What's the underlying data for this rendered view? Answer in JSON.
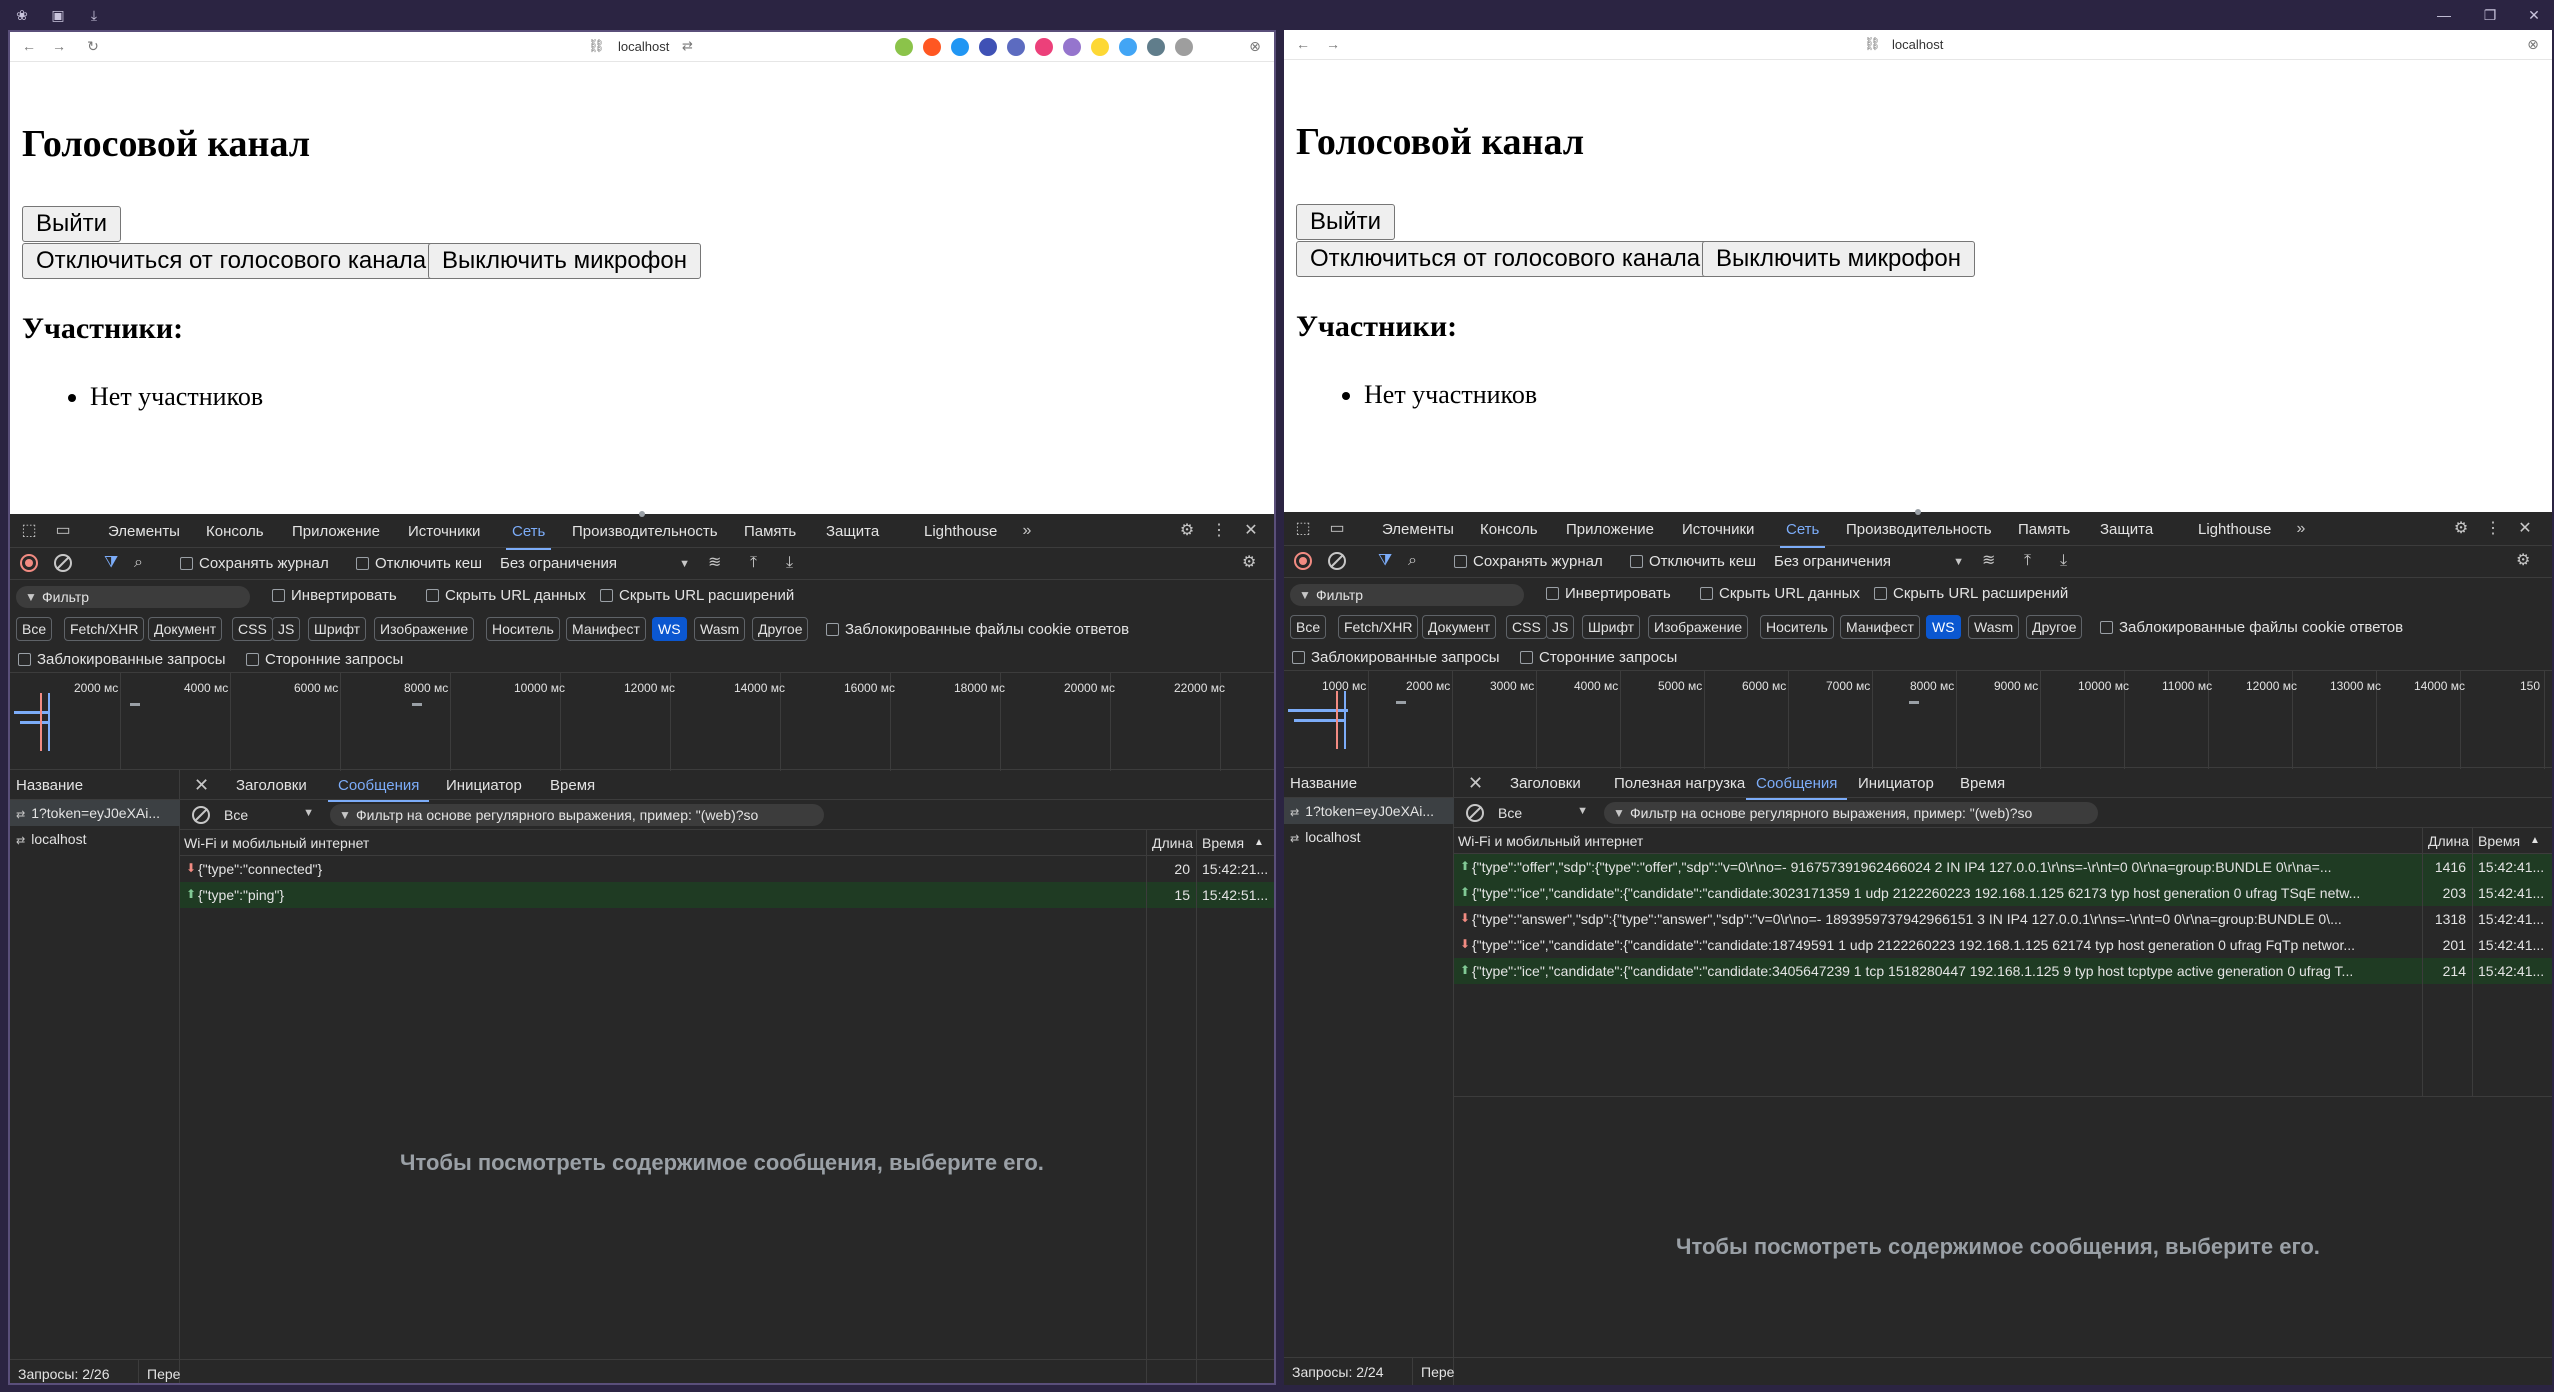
{
  "left": {
    "url": "localhost",
    "page": {
      "title": "Голосовой канал",
      "logout_label": "Выйти",
      "disconnect_label": "Отключиться от голосового канала",
      "mute_label": "Выключить микрофон",
      "participants_heading": "Участники:",
      "participants": [
        "Нет участников"
      ]
    },
    "devtools": {
      "tabs": [
        "Элементы",
        "Консоль",
        "Приложение",
        "Источники",
        "Сеть",
        "Производительность",
        "Память",
        "Защита",
        "Lighthouse"
      ],
      "active_tab": "Сеть",
      "preserve_log": "Сохранять журнал",
      "disable_cache": "Отключить кеш",
      "throttling": "Без ограничения",
      "filter_placeholder": "Фильтр",
      "invert": "Инвертировать",
      "hide_data_urls": "Скрыть URL данных",
      "hide_ext_urls": "Скрыть URL расширений",
      "type_filters": [
        "Все",
        "Fetch/XHR",
        "Документ",
        "CSS",
        "JS",
        "Шрифт",
        "Изображение",
        "Носитель",
        "Манифест",
        "WS",
        "Wasm",
        "Другое"
      ],
      "selected_type": "WS",
      "blocked_cookies": "Заблокированные файлы cookie ответов",
      "blocked_requests": "Заблокированные запросы",
      "third_party": "Сторонние запросы",
      "timeline_ticks": [
        "2000 мс",
        "4000 мс",
        "6000 мс",
        "8000 мс",
        "10000 мс",
        "12000 мс",
        "14000 мс",
        "16000 мс",
        "18000 мс",
        "20000 мс",
        "22000 мс"
      ],
      "name_header": "Название",
      "requests": [
        "1?token=eyJ0eXAi...",
        "localhost"
      ],
      "detail_tabs": [
        "Заголовки",
        "Сообщения",
        "Инициатор",
        "Время"
      ],
      "active_detail_tab": "Сообщения",
      "msg_filter_select": "Все",
      "msg_filter_placeholder": "Фильтр на основе регулярного выражения, пример: \"(web)?so",
      "msg_header": "Wi-Fi и мобильный интернет",
      "len_header": "Длина",
      "time_header": "Время",
      "messages": [
        {
          "dir": "down",
          "data": "{\"type\":\"connected\"}",
          "length": "20",
          "time": "15:42:21..."
        },
        {
          "dir": "up",
          "data": "{\"type\":\"ping\"}",
          "length": "15",
          "time": "15:42:51..."
        }
      ],
      "empty_text": "Чтобы посмотреть содержимое сообщения, выберите его.",
      "status_requests": "Запросы: 2/26",
      "status_transfer": "Пере"
    }
  },
  "right": {
    "url": "localhost",
    "page": {
      "title": "Голосовой канал",
      "logout_label": "Выйти",
      "disconnect_label": "Отключиться от голосового канала",
      "mute_label": "Выключить микрофон",
      "participants_heading": "Участники:",
      "participants": [
        "Нет участников"
      ]
    },
    "devtools": {
      "tabs": [
        "Элементы",
        "Консоль",
        "Приложение",
        "Источники",
        "Сеть",
        "Производительность",
        "Память",
        "Защита",
        "Lighthouse"
      ],
      "active_tab": "Сеть",
      "preserve_log": "Сохранять журнал",
      "disable_cache": "Отключить кеш",
      "throttling": "Без ограничения",
      "filter_placeholder": "Фильтр",
      "invert": "Инвертировать",
      "hide_data_urls": "Скрыть URL данных",
      "hide_ext_urls": "Скрыть URL расширений",
      "type_filters": [
        "Все",
        "Fetch/XHR",
        "Документ",
        "CSS",
        "JS",
        "Шрифт",
        "Изображение",
        "Носитель",
        "Манифест",
        "WS",
        "Wasm",
        "Другое"
      ],
      "selected_type": "WS",
      "blocked_cookies": "Заблокированные файлы cookie ответов",
      "blocked_requests": "Заблокированные запросы",
      "third_party": "Сторонние запросы",
      "timeline_ticks": [
        "1000 мс",
        "2000 мс",
        "3000 мс",
        "4000 мс",
        "5000 мс",
        "6000 мс",
        "7000 мс",
        "8000 мс",
        "9000 мс",
        "10000 мс",
        "11000 мс",
        "12000 мс",
        "13000 мс",
        "14000 мс",
        "150"
      ],
      "name_header": "Название",
      "requests": [
        "1?token=eyJ0eXAi...",
        "localhost"
      ],
      "detail_tabs": [
        "Заголовки",
        "Полезная нагрузка",
        "Сообщения",
        "Инициатор",
        "Время"
      ],
      "active_detail_tab": "Сообщения",
      "msg_filter_select": "Все",
      "msg_filter_placeholder": "Фильтр на основе регулярного выражения, пример: \"(web)?so",
      "msg_header": "Wi-Fi и мобильный интернет",
      "len_header": "Длина",
      "time_header": "Время",
      "messages": [
        {
          "dir": "up",
          "data": "{\"type\":\"offer\",\"sdp\":{\"type\":\"offer\",\"sdp\":\"v=0\\r\\no=- 916757391962466024 2 IN IP4 127.0.0.1\\r\\ns=-\\r\\nt=0 0\\r\\na=group:BUNDLE 0\\r\\na=...",
          "length": "1416",
          "time": "15:42:41..."
        },
        {
          "dir": "up",
          "data": "{\"type\":\"ice\",\"candidate\":{\"candidate\":\"candidate:3023171359 1 udp 2122260223 192.168.1.125 62173 typ host generation 0 ufrag TSqE netw...",
          "length": "203",
          "time": "15:42:41..."
        },
        {
          "dir": "down",
          "data": "{\"type\":\"answer\",\"sdp\":{\"type\":\"answer\",\"sdp\":\"v=0\\r\\no=- 1893959737942966151 3 IN IP4 127.0.0.1\\r\\ns=-\\r\\nt=0 0\\r\\na=group:BUNDLE 0\\...",
          "length": "1318",
          "time": "15:42:41..."
        },
        {
          "dir": "down",
          "data": "{\"type\":\"ice\",\"candidate\":{\"candidate\":\"candidate:18749591 1 udp 2122260223 192.168.1.125 62174 typ host generation 0 ufrag FqTp networ...",
          "length": "201",
          "time": "15:42:41..."
        },
        {
          "dir": "up",
          "data": "{\"type\":\"ice\",\"candidate\":{\"candidate\":\"candidate:3405647239 1 tcp 1518280447 192.168.1.125 9 typ host tcptype active generation 0 ufrag T...",
          "length": "214",
          "time": "15:42:41..."
        }
      ],
      "empty_text": "Чтобы посмотреть содержимое сообщения, выберите его.",
      "status_requests": "Запросы: 2/24",
      "status_transfer": "Пере"
    }
  },
  "colors": {
    "accent": "#7cacf8",
    "ws_chip": "#0b57d0",
    "sent_row": "#1f3b23",
    "record": "#f28b82",
    "devtools_bg": "#282828"
  }
}
